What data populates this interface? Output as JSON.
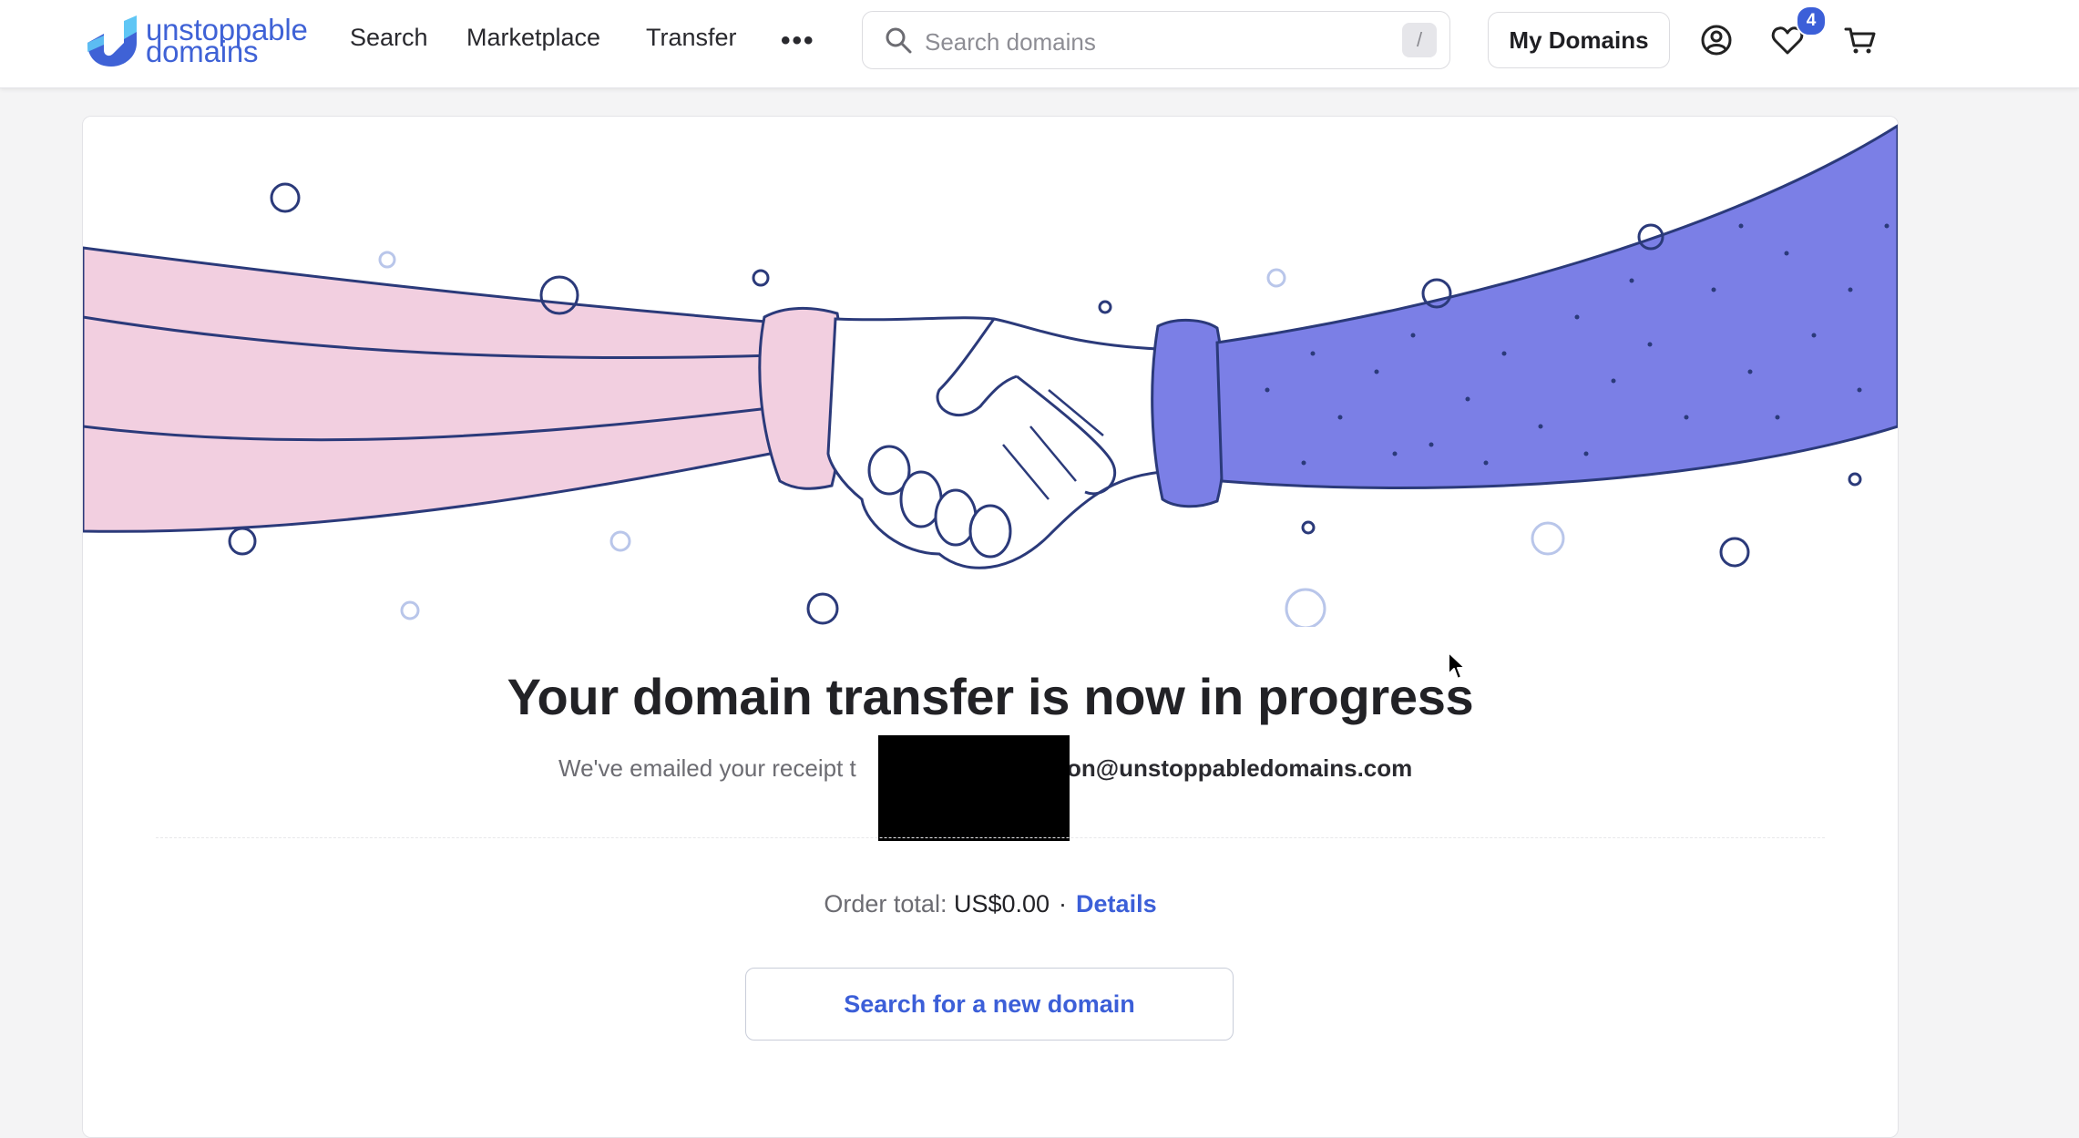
{
  "header": {
    "logo": {
      "line1": "unstoppable",
      "line2": "domains",
      "icon": "unstoppable-u-logo"
    },
    "nav": {
      "search": "Search",
      "marketplace": "Marketplace",
      "transfer": "Transfer",
      "more": "•••"
    },
    "search": {
      "placeholder": "Search domains",
      "shortcut": "/"
    },
    "my_domains": "My Domains",
    "icons": {
      "account": "user-circle-icon",
      "favorites": "heart-icon",
      "cart": "cart-icon"
    },
    "favorites_count": "4"
  },
  "main": {
    "illustration": "handshake-illustration",
    "headline": "Your domain transfer is now in progress",
    "receipt_prefix": "We've emailed your receipt t",
    "receipt_email_suffix": "on@unstoppabledomains.com",
    "order_total_label": "Order total:",
    "order_total_value": "US$0.00",
    "separator": "·",
    "details_link": "Details",
    "search_new_button": "Search for a new domain"
  },
  "colors": {
    "brand_blue": "#3c5fd8",
    "sleeve_pink": "#f2cfe0",
    "sleeve_purple": "#7b7fe6",
    "outline_navy": "#2b3a7a"
  }
}
